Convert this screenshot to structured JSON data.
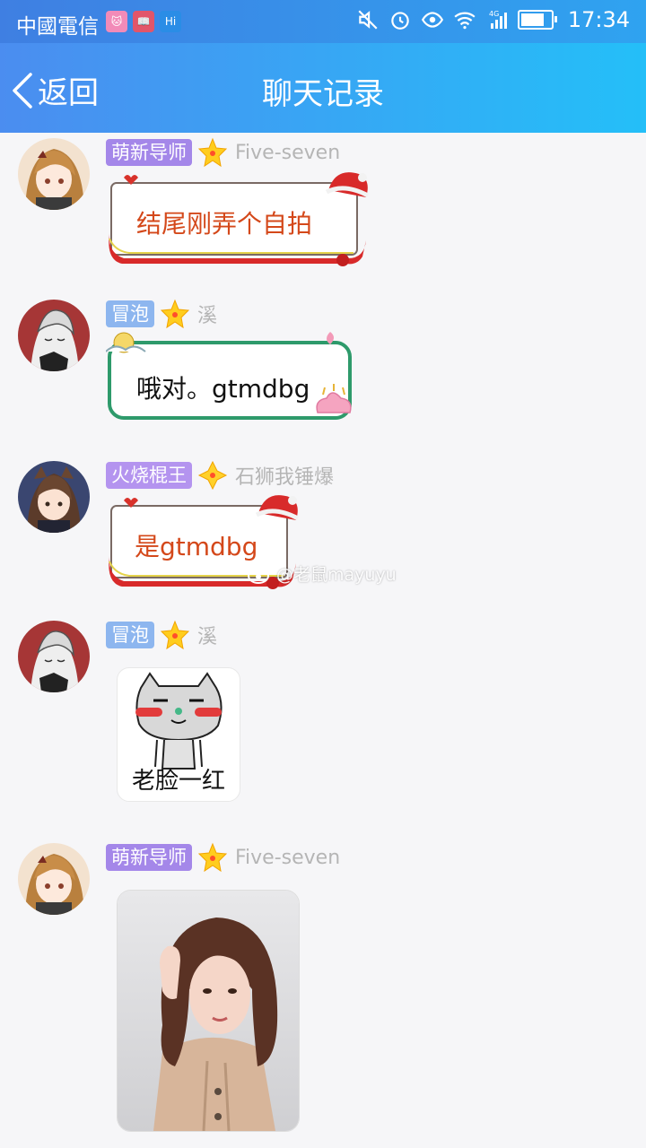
{
  "status_bar": {
    "carrier": "中國電信",
    "time": "17:34",
    "network": "4G",
    "battery_level": 0.85,
    "icons": [
      "muted-icon",
      "alarm-icon",
      "eye-icon",
      "wifi-icon",
      "signal-icon",
      "battery-icon"
    ]
  },
  "header": {
    "back_label": "返回",
    "title": "聊天记录"
  },
  "messages": [
    {
      "badge": "萌新导师",
      "badge_color": "#a487e9",
      "nick": "Five-seven",
      "type": "text",
      "text": "结尾刚弄个自拍",
      "text_color": "#d4481a"
    },
    {
      "badge": "冒泡",
      "badge_color": "#8db6ef",
      "nick": "溪",
      "type": "text",
      "text": "哦对。gtmdbg",
      "text_color": "#111111"
    },
    {
      "badge": "火烧棍王",
      "badge_color": "#b494ef",
      "nick": "石狮我锤爆",
      "type": "text",
      "text": "是gtmdbg",
      "text_color": "#d4481a"
    },
    {
      "badge": "冒泡",
      "badge_color": "#8db6ef",
      "nick": "溪",
      "type": "sticker",
      "caption": "老脸一红"
    },
    {
      "badge": "萌新导师",
      "badge_color": "#a487e9",
      "nick": "Five-seven",
      "type": "image"
    }
  ],
  "watermark": "@老鼠mayuyu",
  "colors": {
    "header_start": "#4b8df0",
    "header_end": "#24bff8",
    "background": "#f6f6f8"
  }
}
